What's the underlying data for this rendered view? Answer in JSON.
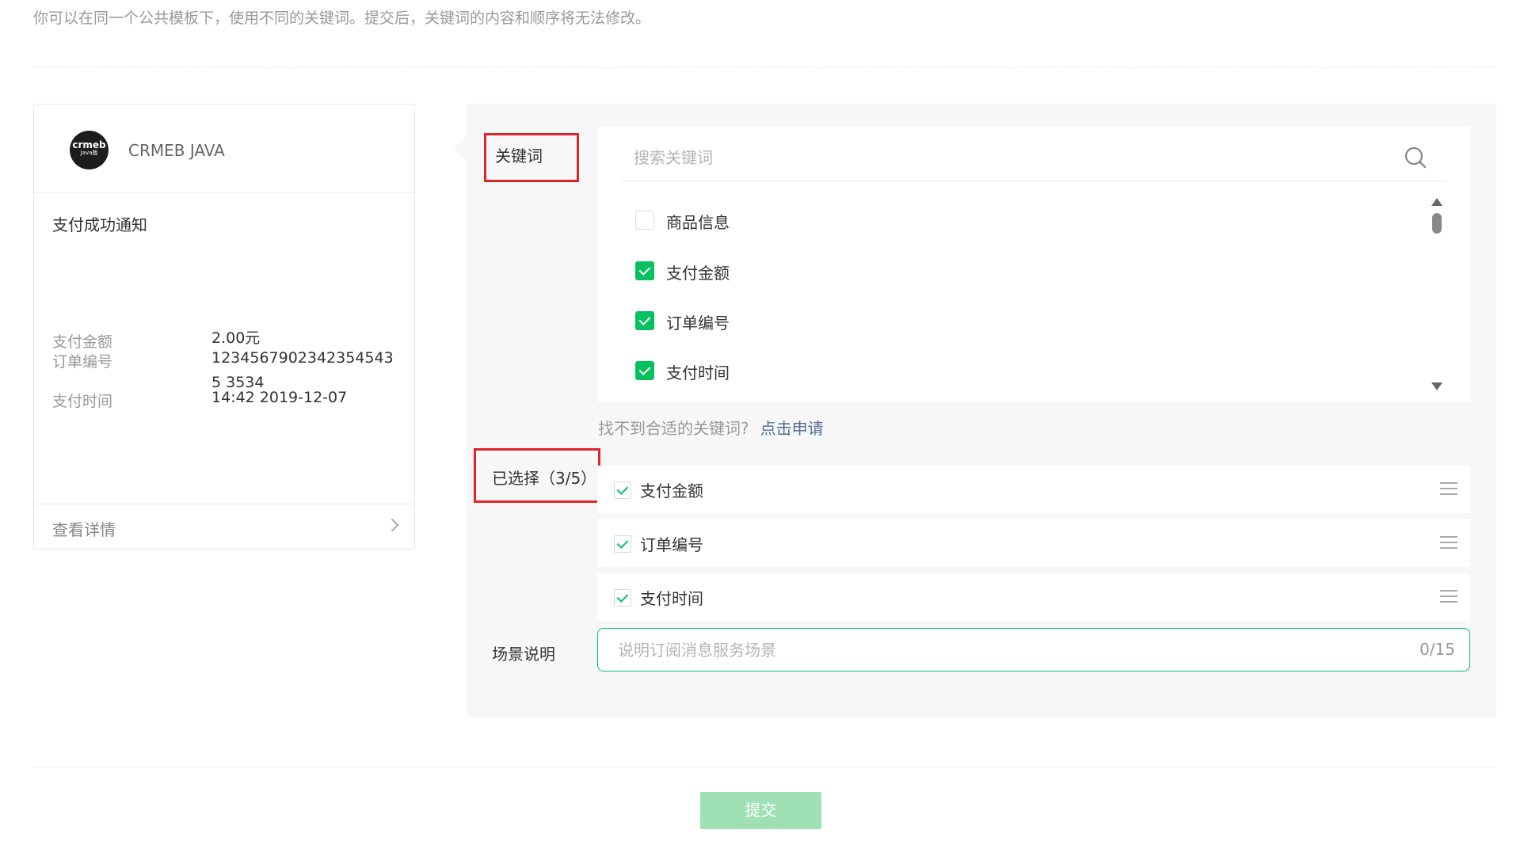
{
  "intro": "你可以在同一个公共模板下，使用不同的关键词。提交后，关键词的内容和顺序将无法修改。",
  "preview": {
    "logo_text_main": "crmeb",
    "logo_text_sub": "Java版",
    "brand": "CRMEB JAVA",
    "title": "支付成功通知",
    "rows": [
      {
        "label": "支付金额",
        "value": "2.00元"
      },
      {
        "label": "订单编号",
        "value": "12345679023423545435 3534"
      },
      {
        "label": "支付时间",
        "value": "14:42 2019-12-07"
      }
    ],
    "detail_label": "查看详情"
  },
  "keywords": {
    "label": "关键词",
    "search_placeholder": "搜索关键词",
    "items": [
      {
        "text": "商品信息",
        "checked": false
      },
      {
        "text": "支付金额",
        "checked": true
      },
      {
        "text": "订单编号",
        "checked": true
      },
      {
        "text": "支付时间",
        "checked": true
      }
    ],
    "not_found": "找不到合适的关键词?",
    "apply_link": "点击申请"
  },
  "selected": {
    "label": "已选择（3/5）",
    "items": [
      "支付金额",
      "订单编号",
      "支付时间"
    ]
  },
  "scene": {
    "label": "场景说明",
    "placeholder": "说明订阅消息服务场景",
    "counter": "0/15"
  },
  "submit_label": "提交",
  "colors": {
    "accent": "#07c160",
    "highlight_box": "#e0242e",
    "link": "#576b95",
    "submit_disabled": "#9fe0b5"
  }
}
